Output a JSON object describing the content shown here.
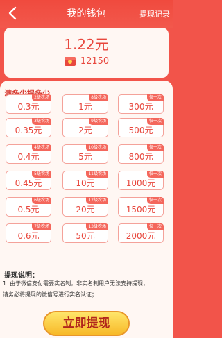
{
  "header": {
    "title": "我的钱包",
    "history_label": "提现记录"
  },
  "balance": {
    "amount": "1.22元",
    "coins": "12150"
  },
  "options": {
    "title": "满多少提多少",
    "columns": [
      [
        {
          "tag": "2级农场",
          "amount": "0.3元"
        },
        {
          "tag": "3级农场",
          "amount": "0.35元"
        },
        {
          "tag": "4级农场",
          "amount": "0.4元"
        },
        {
          "tag": "5级农场",
          "amount": "0.45元"
        },
        {
          "tag": "6级农场",
          "amount": "0.5元"
        },
        {
          "tag": "7级农场",
          "amount": "0.6元"
        }
      ],
      [
        {
          "tag": "8级农场",
          "amount": "1元"
        },
        {
          "tag": "9级农场",
          "amount": "2元"
        },
        {
          "tag": "10级农场",
          "amount": "5元"
        },
        {
          "tag": "11级农场",
          "amount": "10元"
        },
        {
          "tag": "12级农场",
          "amount": "20元"
        },
        {
          "tag": "13级农场",
          "amount": "50元"
        }
      ],
      [
        {
          "tag": "仅一次",
          "amount": "300元"
        },
        {
          "tag": "仅一次",
          "amount": "500元"
        },
        {
          "tag": "仅一次",
          "amount": "800元"
        },
        {
          "tag": "仅一次",
          "amount": "1000元"
        },
        {
          "tag": "仅一次",
          "amount": "1500元"
        },
        {
          "tag": "仅一次",
          "amount": "2000元"
        }
      ]
    ]
  },
  "notes": {
    "title": "提现说明：",
    "lines": [
      "1. 由于微信支付需要实名制，非实名制用户无法支持提现，",
      "请务必将提现的微信号进行实名认证；"
    ]
  },
  "cta": {
    "label": "立即提现"
  },
  "colors": {
    "background": "#f2544a",
    "accent": "#e8473d",
    "tile_border": "#f4a29a",
    "button": "#f7b928"
  }
}
